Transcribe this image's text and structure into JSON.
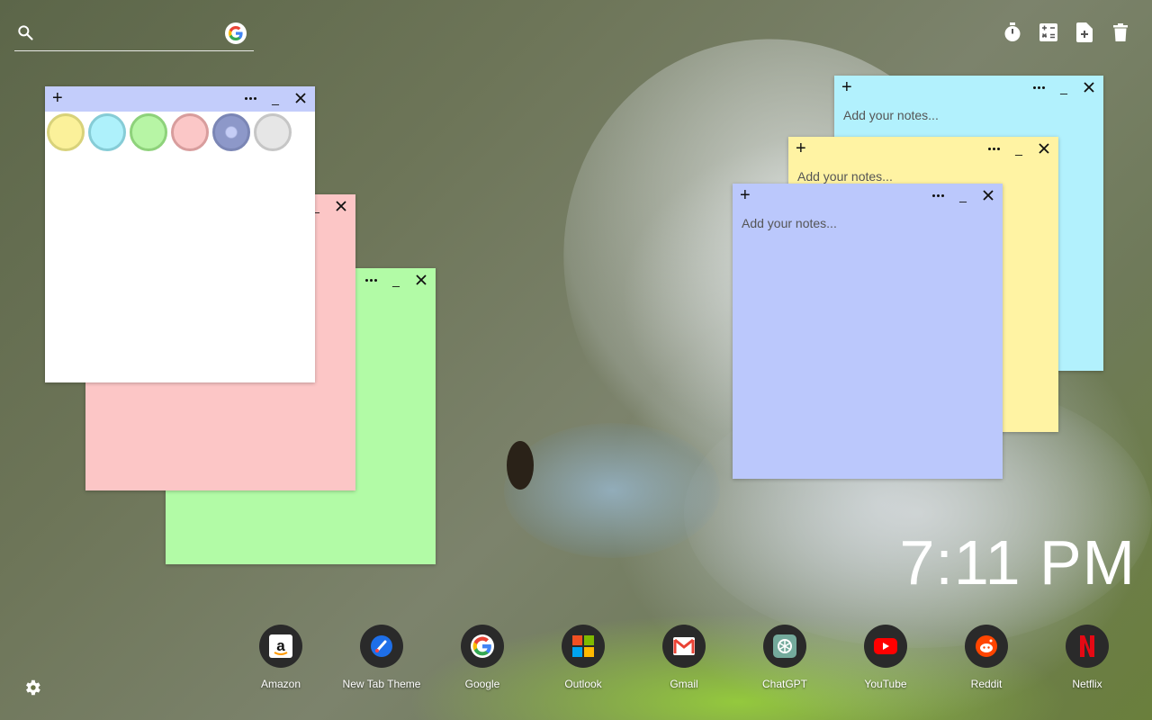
{
  "search": {
    "value": "",
    "placeholder": ""
  },
  "notes": {
    "placeholder": "Add your notes...",
    "palette_colors": [
      "#fbf19a",
      "#aef1fb",
      "#b7f5a5",
      "#fbc7c7",
      "#8d98c9",
      "#e6e6e6"
    ]
  },
  "clock": {
    "time": "7:11 PM"
  },
  "shortcuts": [
    {
      "label": "Amazon"
    },
    {
      "label": "New Tab Theme"
    },
    {
      "label": "Google"
    },
    {
      "label": "Outlook"
    },
    {
      "label": "Gmail"
    },
    {
      "label": "ChatGPT"
    },
    {
      "label": "YouTube"
    },
    {
      "label": "Reddit"
    },
    {
      "label": "Netflix"
    }
  ],
  "colors": {
    "note_white": "#ffffff",
    "note_white_bar": "#c3cdfb",
    "note_pink": "#fcc6c6",
    "note_green": "#b2fba6",
    "note_cyan": "#b2f1fd",
    "note_yellow": "#fff3a3",
    "note_blue": "#bbc8fc"
  }
}
